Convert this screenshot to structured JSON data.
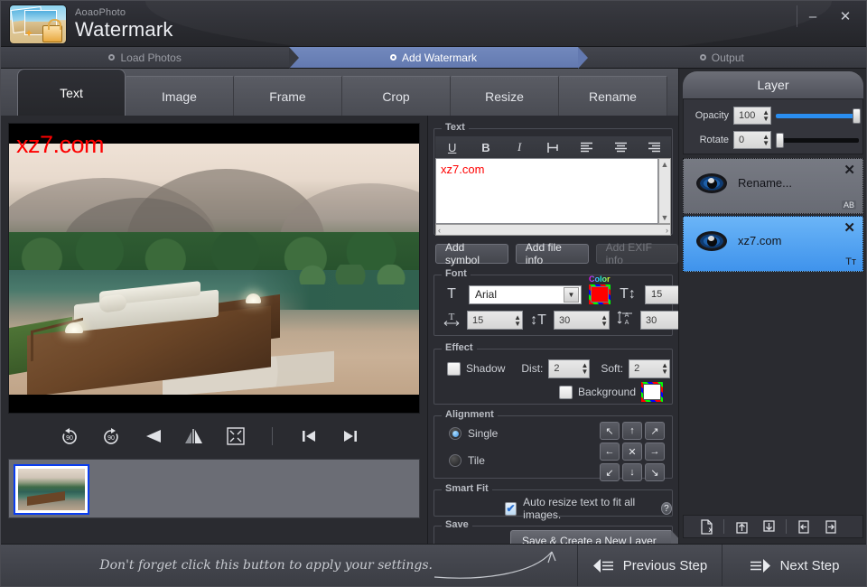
{
  "window": {
    "brand_small": "AoaoPhoto",
    "brand_large": "Watermark",
    "minimize_label": "–",
    "close_label": "✕"
  },
  "steps": [
    {
      "label": "Load Photos",
      "active": false
    },
    {
      "label": "Add Watermark",
      "active": true
    },
    {
      "label": "Output",
      "active": false
    }
  ],
  "tabs": [
    {
      "label": "Text",
      "active": true
    },
    {
      "label": "Image",
      "active": false
    },
    {
      "label": "Frame",
      "active": false
    },
    {
      "label": "Crop",
      "active": false
    },
    {
      "label": "Resize",
      "active": false
    },
    {
      "label": "Rename",
      "active": false
    }
  ],
  "preview": {
    "watermark_text": "xz7.com",
    "watermark_color": "#fe0000",
    "tools": [
      {
        "name": "rotate-left-90-icon",
        "label": "90"
      },
      {
        "name": "rotate-right-90-icon",
        "label": "90"
      },
      {
        "name": "flip-horizontal-icon",
        "label": "◀"
      },
      {
        "name": "flip-vertical-icon",
        "label": "▮"
      },
      {
        "name": "fit-to-screen-icon",
        "label": "⛶"
      },
      {
        "name": "previous-image-icon",
        "label": "⏮"
      },
      {
        "name": "next-image-icon",
        "label": "⏭"
      }
    ]
  },
  "text_group": {
    "legend": "Text",
    "format_buttons": [
      {
        "name": "underline-icon",
        "label": "U"
      },
      {
        "name": "bold-icon",
        "label": "B"
      },
      {
        "name": "italic-icon",
        "label": "I"
      },
      {
        "name": "indent-icon",
        "label": "⊢"
      },
      {
        "name": "align-left-icon",
        "label": "☰"
      },
      {
        "name": "align-center-icon",
        "label": "☰"
      },
      {
        "name": "align-right-icon",
        "label": "☰"
      }
    ],
    "content": "xz7.com",
    "scroll_up": "▲",
    "scroll_down": "▼",
    "scroll_left": "‹",
    "scroll_right": "›"
  },
  "action_buttons": [
    {
      "label": "Add symbol",
      "enabled": true
    },
    {
      "label": "Add file info",
      "enabled": true
    },
    {
      "label": "Add EXIF info",
      "enabled": false
    }
  ],
  "font_group": {
    "legend": "Font",
    "color_label": "Color",
    "family": "Arial",
    "color": "#ff0000",
    "size": "15",
    "width": "15",
    "line_height": "30",
    "char_spacing": "30",
    "dropdown_caret": "▼"
  },
  "effect_group": {
    "legend": "Effect",
    "shadow_label": "Shadow",
    "shadow_checked": false,
    "dist_label": "Dist:",
    "dist_value": "2",
    "soft_label": "Soft:",
    "soft_value": "2",
    "shadow_color": "#000000",
    "background_label": "Background",
    "background_checked": false,
    "background_color": "#ffffff"
  },
  "alignment_group": {
    "legend": "Alignment",
    "single_label": "Single",
    "tile_label": "Tile",
    "mode": "Single",
    "pads": [
      {
        "name": "align-top-left-icon",
        "glyph": "↖"
      },
      {
        "name": "align-top-center-icon",
        "glyph": "↑"
      },
      {
        "name": "align-top-right-icon",
        "glyph": "↗"
      },
      {
        "name": "align-middle-left-icon",
        "glyph": "←"
      },
      {
        "name": "align-center-icon",
        "glyph": "✕"
      },
      {
        "name": "align-middle-right-icon",
        "glyph": "→"
      },
      {
        "name": "align-bottom-left-icon",
        "glyph": "↙"
      },
      {
        "name": "align-bottom-center-icon",
        "glyph": "↓"
      },
      {
        "name": "align-bottom-right-icon",
        "glyph": "↘"
      }
    ]
  },
  "smart_fit_group": {
    "legend": "Smart Fit",
    "checkbox_label": "Auto resize text to fit all images.",
    "checked": true,
    "check_glyph": "✔",
    "help_glyph": "?"
  },
  "save_group": {
    "legend": "Save",
    "button_label": "Save & Create a New Layer"
  },
  "layer_panel": {
    "title": "Layer",
    "opacity_label": "Opacity",
    "opacity_value": "100",
    "rotate_label": "Rotate",
    "rotate_value": "0",
    "layers": [
      {
        "name": "Rename...",
        "selected": false,
        "type_badge": "AB"
      },
      {
        "name": "xz7.com",
        "selected": true,
        "type_badge": "Tᴛ"
      }
    ],
    "close_glyph": "✕",
    "tools": [
      {
        "name": "delete-layer-icon",
        "glyph": "⌧"
      },
      {
        "name": "load-layer-icon",
        "glyph": "⤒"
      },
      {
        "name": "save-layer-icon",
        "glyph": "⤓"
      },
      {
        "name": "import-template-icon",
        "glyph": "↤"
      },
      {
        "name": "export-template-icon",
        "glyph": "↦"
      }
    ]
  },
  "footer": {
    "hint": "Don't forget click this button to apply your settings.",
    "previous_label": "Previous Step",
    "next_label": "Next Step"
  }
}
